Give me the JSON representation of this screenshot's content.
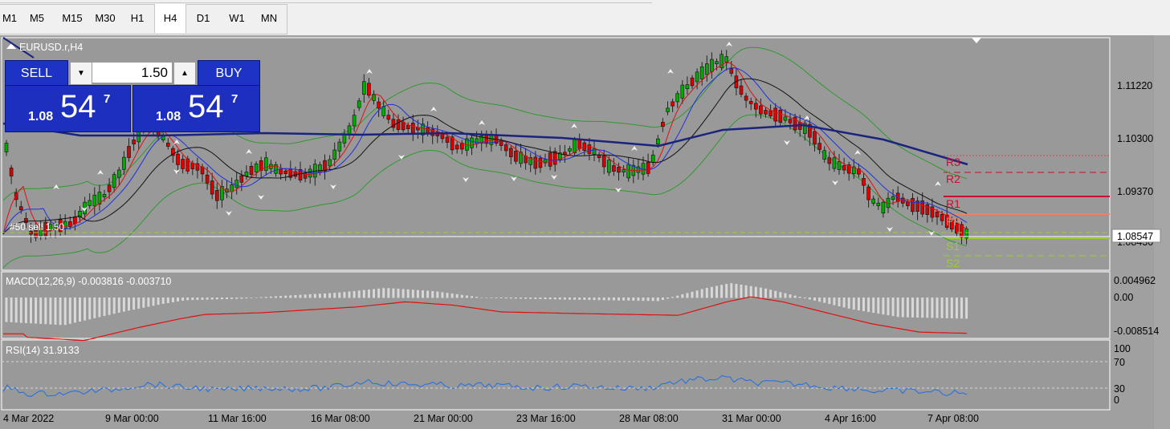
{
  "toolbar": {
    "timeframes": [
      {
        "label": "M1",
        "active": false
      },
      {
        "label": "M5",
        "active": false
      },
      {
        "label": "M15",
        "active": false
      },
      {
        "label": "M30",
        "active": false
      },
      {
        "label": "H1",
        "active": false
      },
      {
        "label": "H4",
        "active": true
      },
      {
        "label": "D1",
        "active": false
      },
      {
        "label": "W1",
        "active": false
      },
      {
        "label": "MN",
        "active": false
      }
    ]
  },
  "chart": {
    "symbol_label": "EURUSD.r,H4",
    "price_axis": [
      "1.11220",
      "1.10300",
      "1.09370",
      "1.08547",
      "1.08430"
    ],
    "current_price": "1.08547",
    "order_line_label": "#50  sell  1.50",
    "pivot_labels": [
      "R3",
      "R2",
      "R1",
      "PP",
      "S1",
      "S2"
    ],
    "date_axis": [
      "4 Mar 2022",
      "9 Mar 00:00",
      "11 Mar 16:00",
      "16 Mar 08:00",
      "21 Mar 00:00",
      "23 Mar 16:00",
      "28 Mar 08:00",
      "31 Mar 00:00",
      "4 Apr 16:00",
      "7 Apr 08:00"
    ],
    "colors": {
      "background": "#999999",
      "bull": "#00aa00",
      "bear": "#dd0000",
      "ma_slow": "#1a237e",
      "macd_signal": "#e01010",
      "rsi_line": "#1e6ee6",
      "r_levels": "#c8102e",
      "s_levels": "#9acd32",
      "pp": "#f08060"
    }
  },
  "macd": {
    "label": "MACD(12,26,9) -0.003816 -0.003710",
    "axis": [
      "0.004962",
      "0.00",
      "-0.008514"
    ]
  },
  "rsi": {
    "label": "RSI(14) 31.9133",
    "axis": [
      "100",
      "70",
      "30",
      "0"
    ]
  },
  "trade_panel": {
    "sell_label": "SELL",
    "buy_label": "BUY",
    "lot_value": "1.50",
    "down_icon": "▼",
    "up_icon": "▲",
    "sell_price": {
      "small": "1.08",
      "big": "54",
      "sup": "7"
    },
    "buy_price": {
      "small": "1.08",
      "big": "54",
      "sup": "7"
    }
  }
}
